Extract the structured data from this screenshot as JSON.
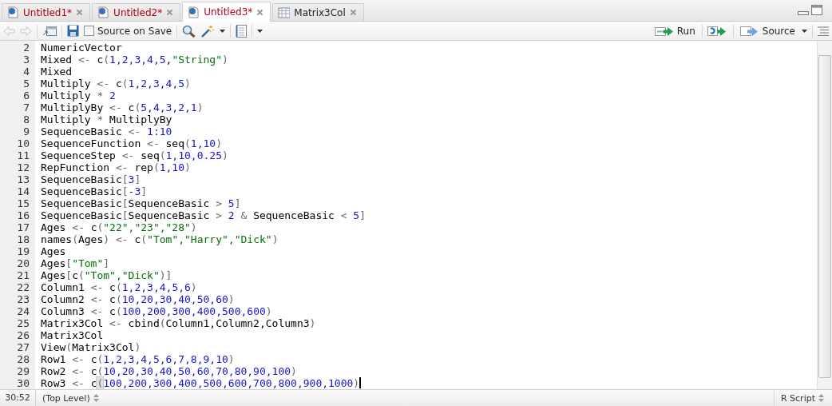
{
  "tabs": [
    {
      "label": "Untitled1*",
      "kind": "script",
      "modified": true,
      "selected": false
    },
    {
      "label": "Untitled2*",
      "kind": "script",
      "modified": true,
      "selected": false
    },
    {
      "label": "Untitled3*",
      "kind": "script",
      "modified": true,
      "selected": true
    },
    {
      "label": "Matrix3Col",
      "kind": "data",
      "modified": false,
      "selected": false
    }
  ],
  "toolbar": {
    "source_on_save": {
      "label": "Source on Save",
      "checked": false
    },
    "run": "Run",
    "source": "Source"
  },
  "editor": {
    "lines": [
      {
        "number": "2",
        "tokens": [
          {
            "kind": "id",
            "text": "NumericVector"
          }
        ]
      },
      {
        "number": "3",
        "tokens": [
          {
            "kind": "id",
            "text": "Mixed "
          },
          {
            "kind": "op",
            "text": "<- "
          },
          {
            "kind": "id",
            "text": "c"
          },
          {
            "kind": "op",
            "text": "("
          },
          {
            "kind": "num",
            "text": "1,2,3,4,5"
          },
          {
            "kind": "id",
            "text": ","
          },
          {
            "kind": "str",
            "text": "\"String\""
          },
          {
            "kind": "op",
            "text": ")"
          }
        ]
      },
      {
        "number": "4",
        "tokens": [
          {
            "kind": "id",
            "text": "Mixed"
          }
        ]
      },
      {
        "number": "5",
        "tokens": [
          {
            "kind": "id",
            "text": "Multiply "
          },
          {
            "kind": "op",
            "text": "<- "
          },
          {
            "kind": "id",
            "text": "c"
          },
          {
            "kind": "op",
            "text": "("
          },
          {
            "kind": "num",
            "text": "1,2,3,4,5"
          },
          {
            "kind": "op",
            "text": ")"
          }
        ]
      },
      {
        "number": "6",
        "tokens": [
          {
            "kind": "id",
            "text": "Multiply "
          },
          {
            "kind": "op",
            "text": "* "
          },
          {
            "kind": "num",
            "text": "2"
          }
        ]
      },
      {
        "number": "7",
        "tokens": [
          {
            "kind": "id",
            "text": "MultiplyBy "
          },
          {
            "kind": "op",
            "text": "<- "
          },
          {
            "kind": "id",
            "text": "c"
          },
          {
            "kind": "op",
            "text": "("
          },
          {
            "kind": "num",
            "text": "5,4,3,2,1"
          },
          {
            "kind": "op",
            "text": ")"
          }
        ]
      },
      {
        "number": "8",
        "tokens": [
          {
            "kind": "id",
            "text": "Multiply "
          },
          {
            "kind": "op",
            "text": "* "
          },
          {
            "kind": "id",
            "text": "MultiplyBy"
          }
        ]
      },
      {
        "number": "9",
        "tokens": [
          {
            "kind": "id",
            "text": "SequenceBasic "
          },
          {
            "kind": "op",
            "text": "<- "
          },
          {
            "kind": "num",
            "text": "1:10"
          }
        ]
      },
      {
        "number": "10",
        "tokens": [
          {
            "kind": "id",
            "text": "SequenceFunction "
          },
          {
            "kind": "op",
            "text": "<- "
          },
          {
            "kind": "id",
            "text": "seq"
          },
          {
            "kind": "op",
            "text": "("
          },
          {
            "kind": "num",
            "text": "1,10"
          },
          {
            "kind": "op",
            "text": ")"
          }
        ]
      },
      {
        "number": "11",
        "tokens": [
          {
            "kind": "id",
            "text": "SequenceStep "
          },
          {
            "kind": "op",
            "text": "<- "
          },
          {
            "kind": "id",
            "text": "seq"
          },
          {
            "kind": "op",
            "text": "("
          },
          {
            "kind": "num",
            "text": "1,10,0.25"
          },
          {
            "kind": "op",
            "text": ")"
          }
        ]
      },
      {
        "number": "12",
        "tokens": [
          {
            "kind": "id",
            "text": "RepFunction "
          },
          {
            "kind": "op",
            "text": "<- "
          },
          {
            "kind": "id",
            "text": "rep"
          },
          {
            "kind": "op",
            "text": "("
          },
          {
            "kind": "num",
            "text": "1,10"
          },
          {
            "kind": "op",
            "text": ")"
          }
        ]
      },
      {
        "number": "13",
        "tokens": [
          {
            "kind": "id",
            "text": "SequenceBasic"
          },
          {
            "kind": "op",
            "text": "["
          },
          {
            "kind": "num",
            "text": "3"
          },
          {
            "kind": "op",
            "text": "]"
          }
        ]
      },
      {
        "number": "14",
        "tokens": [
          {
            "kind": "id",
            "text": "SequenceBasic"
          },
          {
            "kind": "op",
            "text": "["
          },
          {
            "kind": "num",
            "text": "-3"
          },
          {
            "kind": "op",
            "text": "]"
          }
        ]
      },
      {
        "number": "15",
        "tokens": [
          {
            "kind": "id",
            "text": "SequenceBasic"
          },
          {
            "kind": "op",
            "text": "["
          },
          {
            "kind": "id",
            "text": "SequenceBasic "
          },
          {
            "kind": "op",
            "text": "> "
          },
          {
            "kind": "num",
            "text": "5"
          },
          {
            "kind": "op",
            "text": "]"
          }
        ]
      },
      {
        "number": "16",
        "tokens": [
          {
            "kind": "id",
            "text": "SequenceBasic"
          },
          {
            "kind": "op",
            "text": "["
          },
          {
            "kind": "id",
            "text": "SequenceBasic "
          },
          {
            "kind": "op",
            "text": "> "
          },
          {
            "kind": "num",
            "text": "2"
          },
          {
            "kind": "op",
            "text": " & "
          },
          {
            "kind": "id",
            "text": "SequenceBasic "
          },
          {
            "kind": "op",
            "text": "< "
          },
          {
            "kind": "num",
            "text": "5"
          },
          {
            "kind": "op",
            "text": "]"
          }
        ]
      },
      {
        "number": "17",
        "tokens": [
          {
            "kind": "id",
            "text": "Ages "
          },
          {
            "kind": "op",
            "text": "<- "
          },
          {
            "kind": "id",
            "text": "c"
          },
          {
            "kind": "op",
            "text": "("
          },
          {
            "kind": "str",
            "text": "\"22\",\"23\",\"28\""
          },
          {
            "kind": "op",
            "text": ")"
          }
        ]
      },
      {
        "number": "18",
        "tokens": [
          {
            "kind": "id",
            "text": "names"
          },
          {
            "kind": "op",
            "text": "("
          },
          {
            "kind": "id",
            "text": "Ages"
          },
          {
            "kind": "op",
            "text": ") <- "
          },
          {
            "kind": "id",
            "text": "c"
          },
          {
            "kind": "op",
            "text": "("
          },
          {
            "kind": "str",
            "text": "\"Tom\",\"Harry\",\"Dick\""
          },
          {
            "kind": "op",
            "text": ")"
          }
        ]
      },
      {
        "number": "19",
        "tokens": [
          {
            "kind": "id",
            "text": "Ages"
          }
        ]
      },
      {
        "number": "20",
        "tokens": [
          {
            "kind": "id",
            "text": "Ages"
          },
          {
            "kind": "op",
            "text": "["
          },
          {
            "kind": "str",
            "text": "\"Tom\""
          },
          {
            "kind": "op",
            "text": "]"
          }
        ]
      },
      {
        "number": "21",
        "tokens": [
          {
            "kind": "id",
            "text": "Ages"
          },
          {
            "kind": "op",
            "text": "["
          },
          {
            "kind": "id",
            "text": "c"
          },
          {
            "kind": "op",
            "text": "("
          },
          {
            "kind": "str",
            "text": "\"Tom\",\"Dick\""
          },
          {
            "kind": "op",
            "text": ")]"
          }
        ]
      },
      {
        "number": "22",
        "tokens": [
          {
            "kind": "id",
            "text": "Column1 "
          },
          {
            "kind": "op",
            "text": "<- "
          },
          {
            "kind": "id",
            "text": "c"
          },
          {
            "kind": "op",
            "text": "("
          },
          {
            "kind": "num",
            "text": "1,2,3,4,5,6"
          },
          {
            "kind": "op",
            "text": ")"
          }
        ]
      },
      {
        "number": "23",
        "tokens": [
          {
            "kind": "id",
            "text": "Column2 "
          },
          {
            "kind": "op",
            "text": "<- "
          },
          {
            "kind": "id",
            "text": "c"
          },
          {
            "kind": "op",
            "text": "("
          },
          {
            "kind": "num",
            "text": "10,20,30,40,50,60"
          },
          {
            "kind": "op",
            "text": ")"
          }
        ]
      },
      {
        "number": "24",
        "tokens": [
          {
            "kind": "id",
            "text": "Column3 "
          },
          {
            "kind": "op",
            "text": "<- "
          },
          {
            "kind": "id",
            "text": "c"
          },
          {
            "kind": "op",
            "text": "("
          },
          {
            "kind": "num",
            "text": "100,200,300,400,500,600"
          },
          {
            "kind": "op",
            "text": ")"
          }
        ]
      },
      {
        "number": "25",
        "tokens": [
          {
            "kind": "id",
            "text": "Matrix3Col "
          },
          {
            "kind": "op",
            "text": "<- "
          },
          {
            "kind": "id",
            "text": "cbind"
          },
          {
            "kind": "op",
            "text": "("
          },
          {
            "kind": "id",
            "text": "Column1,Column2,Column3"
          },
          {
            "kind": "op",
            "text": ")"
          }
        ]
      },
      {
        "number": "26",
        "tokens": [
          {
            "kind": "id",
            "text": "Matrix3Col"
          }
        ]
      },
      {
        "number": "27",
        "tokens": [
          {
            "kind": "id",
            "text": "View"
          },
          {
            "kind": "op",
            "text": "("
          },
          {
            "kind": "id",
            "text": "Matrix3Col"
          },
          {
            "kind": "op",
            "text": ")"
          }
        ]
      },
      {
        "number": "28",
        "tokens": [
          {
            "kind": "id",
            "text": "Row1 "
          },
          {
            "kind": "op",
            "text": "<- "
          },
          {
            "kind": "id",
            "text": "c"
          },
          {
            "kind": "op",
            "text": "("
          },
          {
            "kind": "num",
            "text": "1,2,3,4,5,6,7,8,9,10"
          },
          {
            "kind": "op",
            "text": ")"
          }
        ]
      },
      {
        "number": "29",
        "tokens": [
          {
            "kind": "id",
            "text": "Row2 "
          },
          {
            "kind": "op",
            "text": "<- "
          },
          {
            "kind": "id",
            "text": "c"
          },
          {
            "kind": "op",
            "text": "("
          },
          {
            "kind": "num",
            "text": "10,20,30,40,50,60,70,80,90,100"
          },
          {
            "kind": "op",
            "text": ")"
          }
        ]
      },
      {
        "number": "30",
        "cursor": true,
        "tokens": [
          {
            "kind": "id",
            "text": "Row3 "
          },
          {
            "kind": "op",
            "text": "<- "
          },
          {
            "kind": "id",
            "text": "c"
          },
          {
            "kind": "match",
            "text": "("
          },
          {
            "kind": "num",
            "text": "100,200,300,400,500,600,700,800,900,1000"
          },
          {
            "kind": "op",
            "text": ")"
          }
        ]
      }
    ]
  },
  "status_bar": {
    "position": "30:52",
    "scope": "(Top Level)",
    "file_type": "R Script"
  }
}
